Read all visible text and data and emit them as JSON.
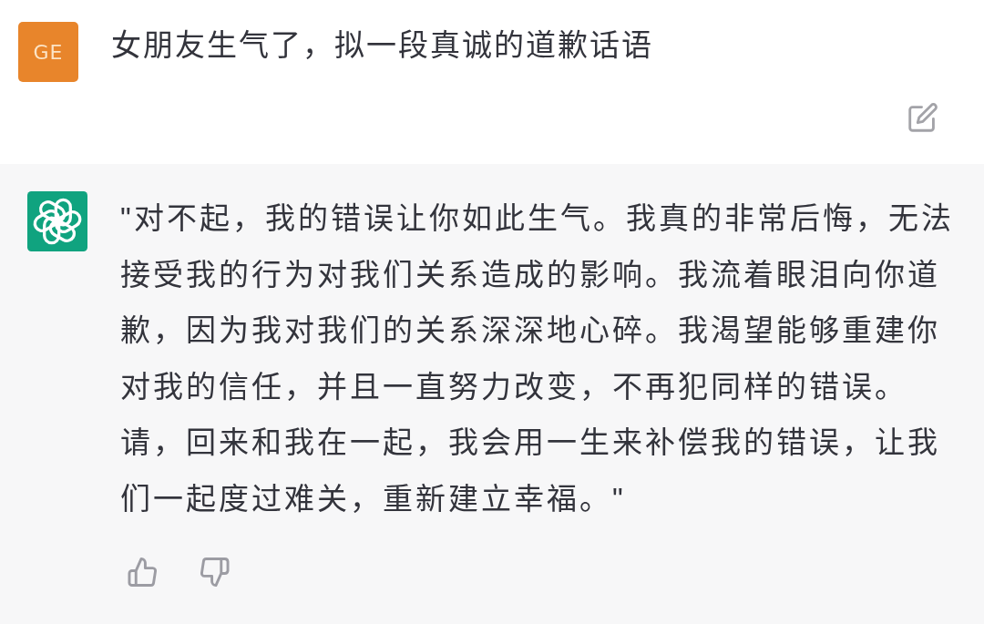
{
  "user_message": {
    "avatar_initials": "GE",
    "text": "女朋友生气了，拟一段真诚的道歉话语"
  },
  "assistant_message": {
    "text": "\"对不起，我的错误让你如此生气。我真的非常后悔，无法接受我的行为对我们关系造成的影响。我流着眼泪向你道歉，因为我对我们的关系深深地心碎。我渴望能够重建你对我的信任，并且一直努力改变，不再犯同样的错误。请，回来和我在一起，我会用一生来补偿我的错误，让我们一起度过难关，重新建立幸福。\""
  }
}
